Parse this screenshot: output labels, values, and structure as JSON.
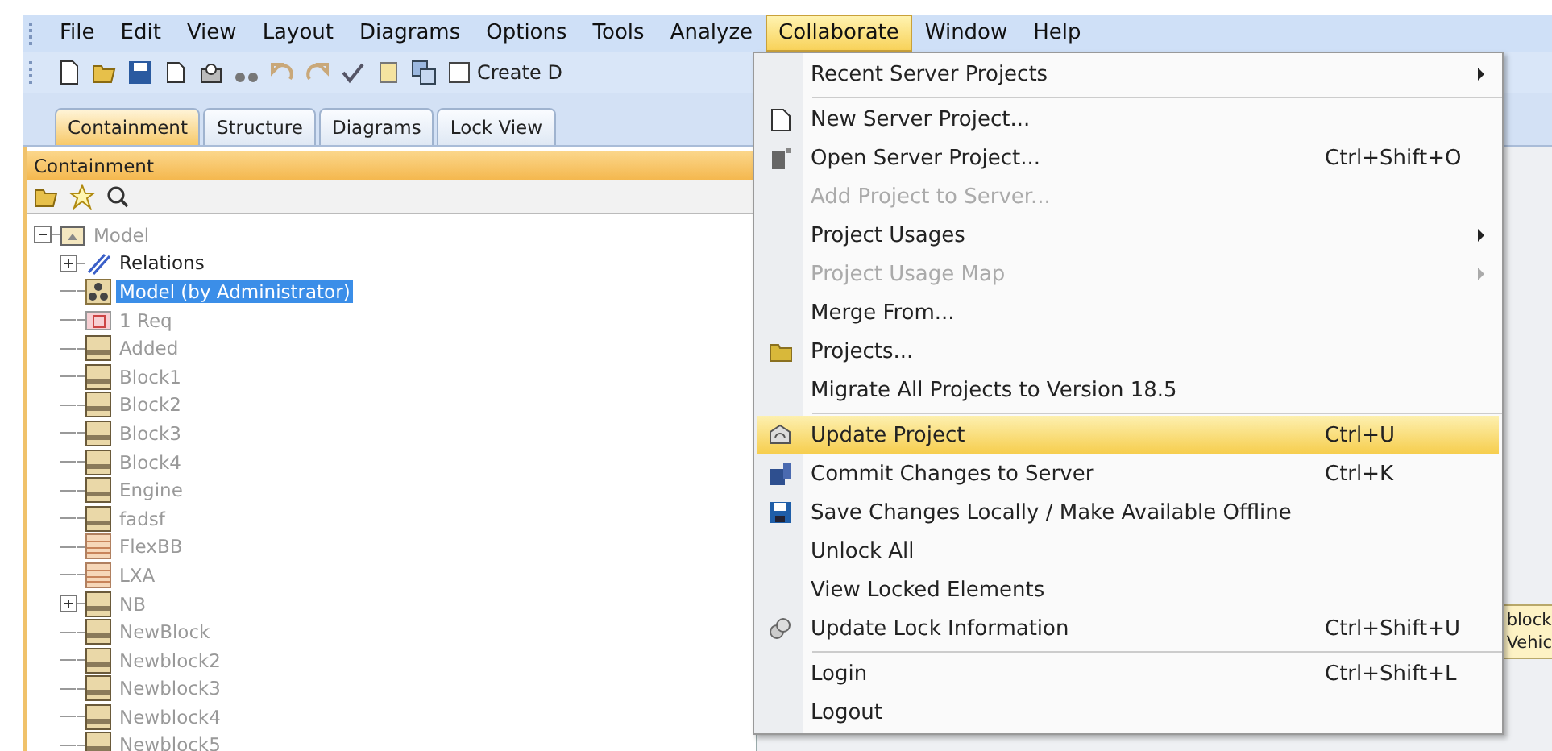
{
  "menubar": [
    {
      "label": "File",
      "selected": false
    },
    {
      "label": "Edit",
      "selected": false
    },
    {
      "label": "View",
      "selected": false
    },
    {
      "label": "Layout",
      "selected": false
    },
    {
      "label": "Diagrams",
      "selected": false
    },
    {
      "label": "Options",
      "selected": false
    },
    {
      "label": "Tools",
      "selected": false
    },
    {
      "label": "Analyze",
      "selected": false
    },
    {
      "label": "Collaborate",
      "selected": true
    },
    {
      "label": "Window",
      "selected": false
    },
    {
      "label": "Help",
      "selected": false
    }
  ],
  "toolbar": {
    "create_button": "Create D"
  },
  "tabs": [
    {
      "label": "Containment",
      "selected": true
    },
    {
      "label": "Structure",
      "selected": false
    },
    {
      "label": "Diagrams",
      "selected": false
    },
    {
      "label": "Lock View",
      "selected": false
    }
  ],
  "panel": {
    "title": "Containment"
  },
  "tree": {
    "label": "Model",
    "kind": "package",
    "dimmed": true,
    "selected": false,
    "expanded": true,
    "children": [
      {
        "label": "Relations",
        "kind": "relations",
        "dimmed": false,
        "selected": false,
        "expanded": false
      },
      {
        "label": "Model (by Administrator)",
        "kind": "model",
        "dimmed": false,
        "selected": true
      },
      {
        "label": "1 Req",
        "kind": "requirement",
        "dimmed": true,
        "selected": false
      },
      {
        "label": "Added",
        "kind": "block",
        "dimmed": true,
        "selected": false
      },
      {
        "label": "Block1",
        "kind": "block",
        "dimmed": true,
        "selected": false
      },
      {
        "label": "Block2",
        "kind": "block",
        "dimmed": true,
        "selected": false
      },
      {
        "label": "Block3",
        "kind": "block",
        "dimmed": true,
        "selected": false
      },
      {
        "label": "Block4",
        "kind": "block",
        "dimmed": true,
        "selected": false
      },
      {
        "label": "Engine",
        "kind": "block",
        "dimmed": true,
        "selected": false
      },
      {
        "label": "fadsf",
        "kind": "block",
        "dimmed": true,
        "selected": false
      },
      {
        "label": "FlexBB",
        "kind": "striped",
        "dimmed": true,
        "selected": false
      },
      {
        "label": "LXA",
        "kind": "striped",
        "dimmed": true,
        "selected": false
      },
      {
        "label": "NB",
        "kind": "block",
        "dimmed": true,
        "selected": false,
        "expanded": false
      },
      {
        "label": "NewBlock",
        "kind": "block",
        "dimmed": true,
        "selected": false
      },
      {
        "label": "Newblock2",
        "kind": "block",
        "dimmed": true,
        "selected": false
      },
      {
        "label": "Newblock3",
        "kind": "block",
        "dimmed": true,
        "selected": false
      },
      {
        "label": "Newblock4",
        "kind": "block",
        "dimmed": true,
        "selected": false
      },
      {
        "label": "Newblock5",
        "kind": "block",
        "dimmed": true,
        "selected": false
      }
    ]
  },
  "tooltip": [
    "block",
    "Vehic"
  ],
  "menu": [
    {
      "kind": "item",
      "label": "Recent Server Projects",
      "submenu": true,
      "disabled": false,
      "selected": false
    },
    {
      "kind": "separator"
    },
    {
      "kind": "item",
      "label": "New Server Project...",
      "disabled": false,
      "selected": false
    },
    {
      "kind": "item",
      "label": "Open Server Project...",
      "shortcut": "Ctrl+Shift+O",
      "disabled": false,
      "selected": false
    },
    {
      "kind": "item",
      "label": "Add Project to Server...",
      "disabled": true,
      "selected": false
    },
    {
      "kind": "item",
      "label": "Project Usages",
      "submenu": true,
      "disabled": false,
      "selected": false
    },
    {
      "kind": "item",
      "label": "Project Usage Map",
      "submenu": true,
      "disabled": true,
      "selected": false
    },
    {
      "kind": "item",
      "label": "Merge From...",
      "disabled": false,
      "selected": false
    },
    {
      "kind": "item",
      "label": "Projects...",
      "disabled": false,
      "selected": false
    },
    {
      "kind": "item",
      "label": "Migrate All Projects to Version 18.5",
      "disabled": false,
      "selected": false
    },
    {
      "kind": "separator"
    },
    {
      "kind": "item",
      "label": "Update Project",
      "shortcut": "Ctrl+U",
      "disabled": false,
      "selected": true
    },
    {
      "kind": "item",
      "label": "Commit Changes to Server",
      "shortcut": "Ctrl+K",
      "disabled": false,
      "selected": false
    },
    {
      "kind": "item",
      "label": "Save Changes Locally / Make Available Offline",
      "disabled": false,
      "selected": false
    },
    {
      "kind": "item",
      "label": "Unlock All",
      "disabled": false,
      "selected": false
    },
    {
      "kind": "item",
      "label": "View Locked Elements",
      "disabled": false,
      "selected": false
    },
    {
      "kind": "item",
      "label": "Update Lock Information",
      "shortcut": "Ctrl+Shift+U",
      "disabled": false,
      "selected": false
    },
    {
      "kind": "separator"
    },
    {
      "kind": "item",
      "label": "Login",
      "shortcut": "Ctrl+Shift+L",
      "disabled": false,
      "selected": false
    },
    {
      "kind": "item",
      "label": "Logout",
      "disabled": false,
      "selected": false
    }
  ]
}
